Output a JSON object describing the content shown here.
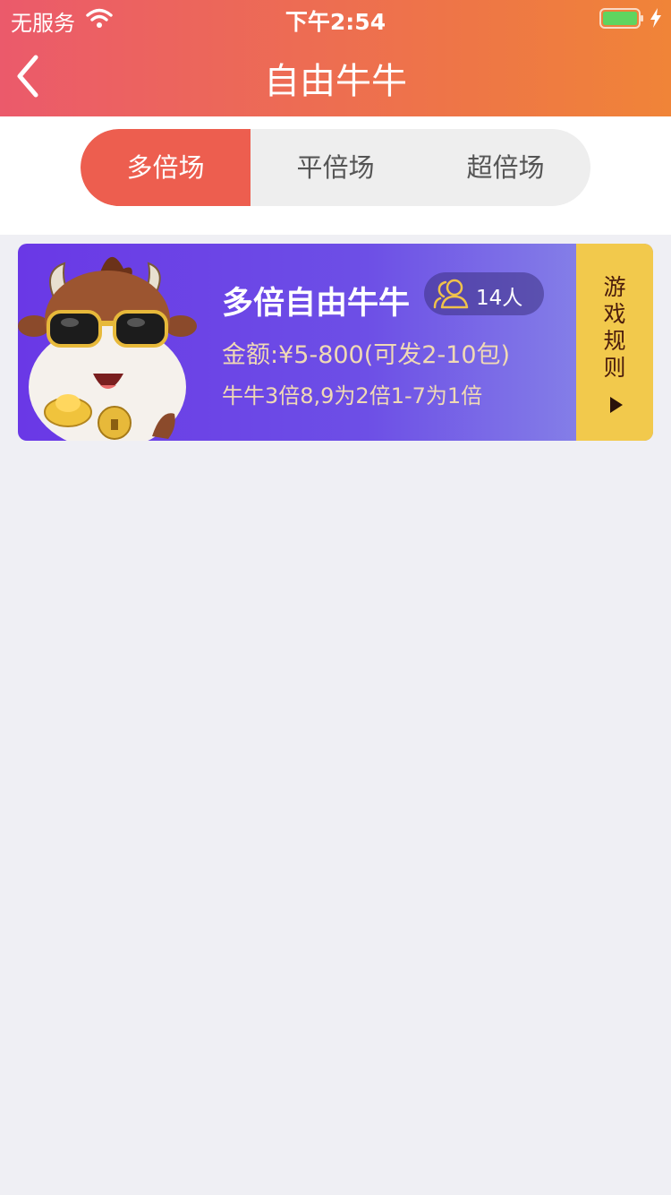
{
  "status_bar": {
    "carrier": "无服务",
    "time": "下午2:54"
  },
  "nav": {
    "title": "自由牛牛",
    "back_icon": "chevron-left-icon"
  },
  "tabs": [
    {
      "label": "多倍场",
      "active": true
    },
    {
      "label": "平倍场",
      "active": false
    },
    {
      "label": "超倍场",
      "active": false
    }
  ],
  "game_card": {
    "title": "多倍自由牛牛",
    "players": "14人",
    "amount": "金额:¥5-800(可发2-10包)",
    "desc": "牛牛3倍8,9为2倍1-7为1倍",
    "rules_chars": [
      "游",
      "戏",
      "规",
      "则"
    ],
    "mascot": "cow-mascot-image"
  },
  "colors": {
    "header_start": "#eb5a6b",
    "header_end": "#f08438",
    "tab_active": "#ed5e4f",
    "card_start": "#6a38e6",
    "card_end": "#8c8fe8",
    "rules_bg": "#f2c94c"
  }
}
